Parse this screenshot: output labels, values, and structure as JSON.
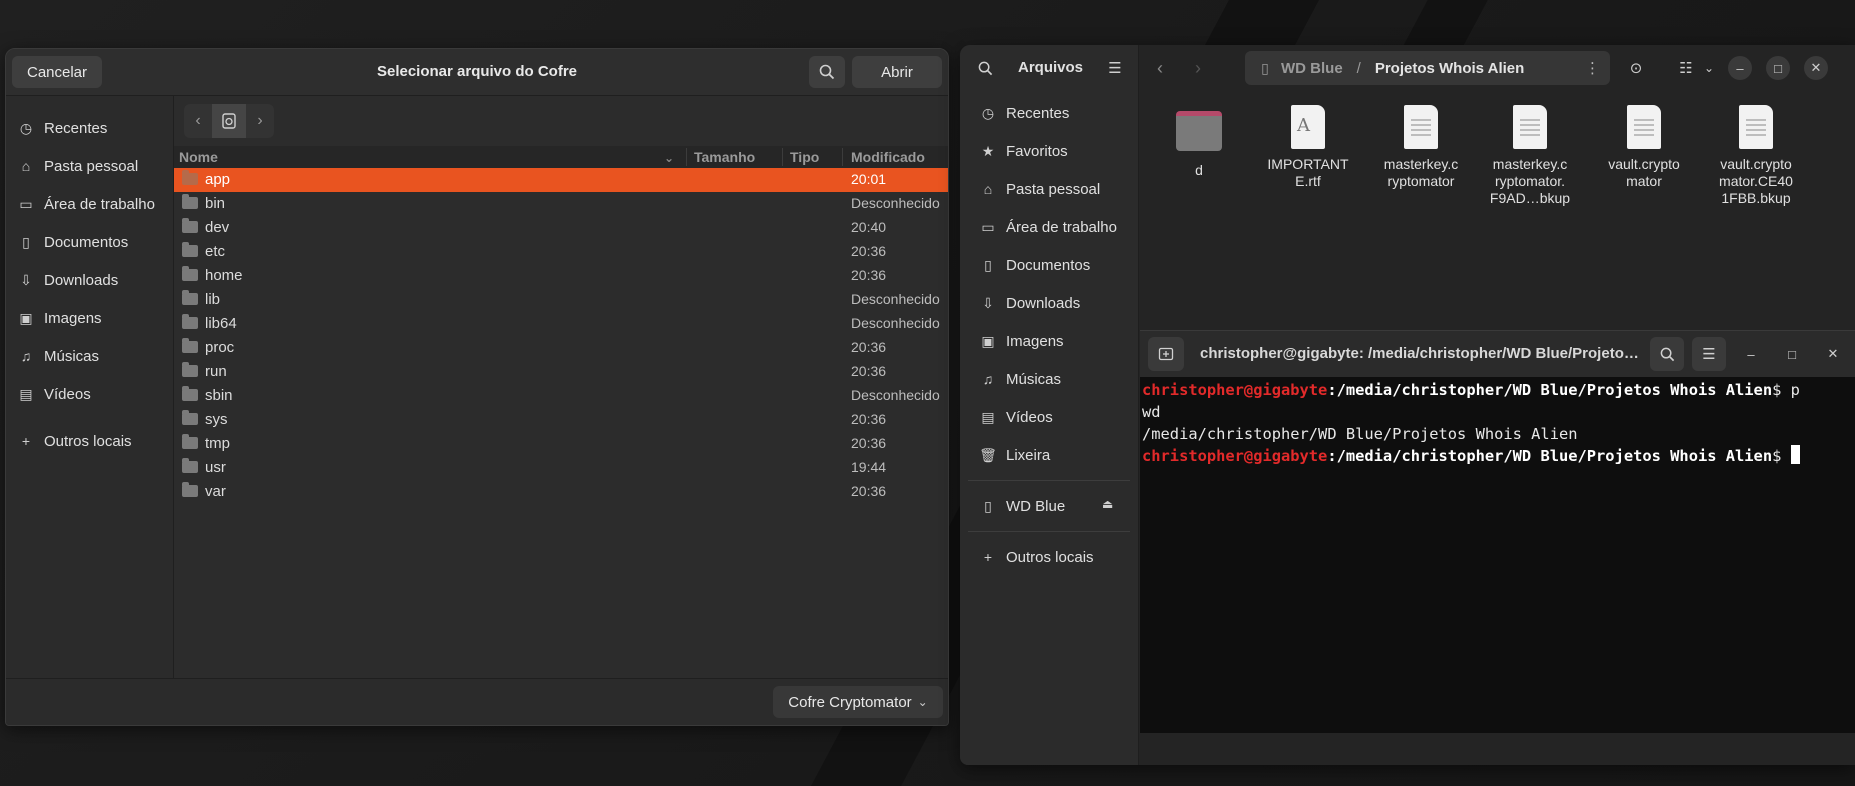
{
  "dialog": {
    "cancel_label": "Cancelar",
    "title": "Selecionar arquivo do Cofre",
    "open_label": "Abrir",
    "sidebar": [
      {
        "label": "Recentes",
        "icon": "clock-icon"
      },
      {
        "label": "Pasta pessoal",
        "icon": "home-icon"
      },
      {
        "label": "Área de trabalho",
        "icon": "desktop-icon"
      },
      {
        "label": "Documentos",
        "icon": "document-icon"
      },
      {
        "label": "Downloads",
        "icon": "download-icon"
      },
      {
        "label": "Imagens",
        "icon": "image-icon"
      },
      {
        "label": "Músicas",
        "icon": "music-icon"
      },
      {
        "label": "Vídeos",
        "icon": "video-icon"
      },
      {
        "label": "Outros locais",
        "icon": "plus-icon"
      }
    ],
    "columns": {
      "name": "Nome",
      "size": "Tamanho",
      "type": "Tipo",
      "modified": "Modificado"
    },
    "files": [
      {
        "name": "app",
        "modified": "20:01",
        "selected": true
      },
      {
        "name": "bin",
        "modified": "Desconhecido"
      },
      {
        "name": "dev",
        "modified": "20:40"
      },
      {
        "name": "etc",
        "modified": "20:36"
      },
      {
        "name": "home",
        "modified": "20:36"
      },
      {
        "name": "lib",
        "modified": "Desconhecido"
      },
      {
        "name": "lib64",
        "modified": "Desconhecido"
      },
      {
        "name": "proc",
        "modified": "20:36"
      },
      {
        "name": "run",
        "modified": "20:36"
      },
      {
        "name": "sbin",
        "modified": "Desconhecido"
      },
      {
        "name": "sys",
        "modified": "20:36"
      },
      {
        "name": "tmp",
        "modified": "20:36"
      },
      {
        "name": "usr",
        "modified": "19:44"
      },
      {
        "name": "var",
        "modified": "20:36"
      }
    ],
    "filter_label": "Cofre Cryptomator"
  },
  "files_window": {
    "title": "Arquivos",
    "sidebar": [
      {
        "label": "Recentes",
        "icon": "clock-icon"
      },
      {
        "label": "Favoritos",
        "icon": "star-icon"
      },
      {
        "label": "Pasta pessoal",
        "icon": "home-icon"
      },
      {
        "label": "Área de trabalho",
        "icon": "desktop-icon"
      },
      {
        "label": "Documentos",
        "icon": "document-icon"
      },
      {
        "label": "Downloads",
        "icon": "download-icon"
      },
      {
        "label": "Imagens",
        "icon": "image-icon"
      },
      {
        "label": "Músicas",
        "icon": "music-icon"
      },
      {
        "label": "Vídeos",
        "icon": "video-icon"
      },
      {
        "label": "Lixeira",
        "icon": "trash-icon"
      }
    ],
    "device": {
      "label": "WD Blue",
      "icon": "drive-icon"
    },
    "other_locations": "Outros locais",
    "location": {
      "root": "WD Blue",
      "separator": "/",
      "folder": "Projetos Whois Alien"
    },
    "items": [
      {
        "name": "d",
        "kind": "folder"
      },
      {
        "name": "IMPORTANT E.rtf",
        "kind": "rtf"
      },
      {
        "name": "masterkey.c ryptomator",
        "kind": "text"
      },
      {
        "name": "masterkey.c ryptomator. F9AD…bkup",
        "kind": "text"
      },
      {
        "name": "vault.crypto mator",
        "kind": "text"
      },
      {
        "name": "vault.crypto mator.CE40 1FBB.bkup",
        "kind": "text"
      }
    ]
  },
  "terminal": {
    "title": "christopher@gigabyte: /media/christopher/WD Blue/Projeto…",
    "lines": [
      {
        "user": "christopher@gigabyte",
        "path": ":/media/christopher/WD Blue/Projetos Whois Alien",
        "prompt": "$ p"
      },
      {
        "text": "wd"
      },
      {
        "text": "/media/christopher/WD Blue/Projetos Whois Alien"
      },
      {
        "user": "christopher@gigabyte",
        "path": ":/media/christopher/WD Blue/Projetos Whois Alien",
        "prompt": "$ "
      }
    ],
    "colors": {
      "user": "#e22a2a",
      "background": "#0e0e0e"
    }
  },
  "colors": {
    "accent": "#e95420",
    "dialog_bg": "#2b2b2b",
    "files_bg": "#242424"
  }
}
